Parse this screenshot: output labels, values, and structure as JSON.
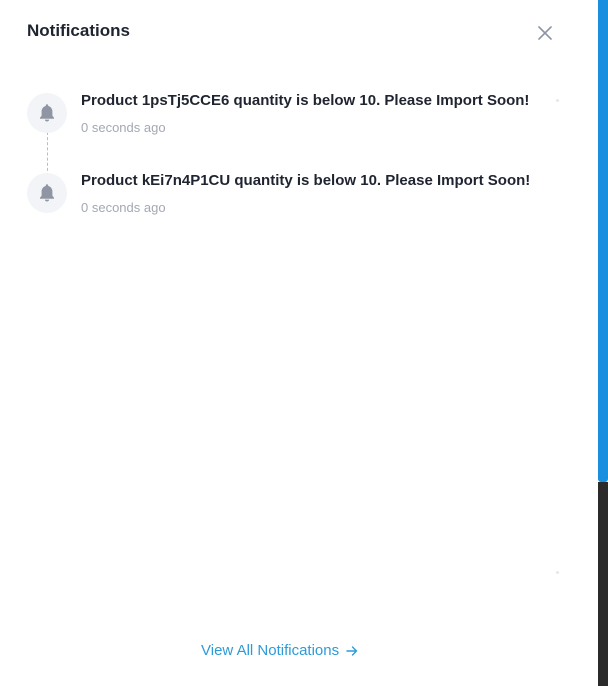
{
  "header": {
    "title": "Notifications",
    "close_icon": "close-icon"
  },
  "notifications": [
    {
      "icon": "bell-icon",
      "message": "Product 1psTj5CCE6 quantity is below 10. Please Import Soon!",
      "time": "0 seconds ago"
    },
    {
      "icon": "bell-icon",
      "message": "Product kEi7n4P1CU quantity is below 10. Please Import Soon!",
      "time": "0 seconds ago"
    }
  ],
  "footer": {
    "view_all_label": "View All Notifications",
    "arrow_icon": "arrow-right-icon"
  },
  "colors": {
    "title": "#1f2430",
    "muted": "#a3a8b3",
    "link": "#2d9bd8",
    "icon": "#8f95a3",
    "icon_bg": "#f3f4f7",
    "scrollbar": "#1a8fe0"
  }
}
